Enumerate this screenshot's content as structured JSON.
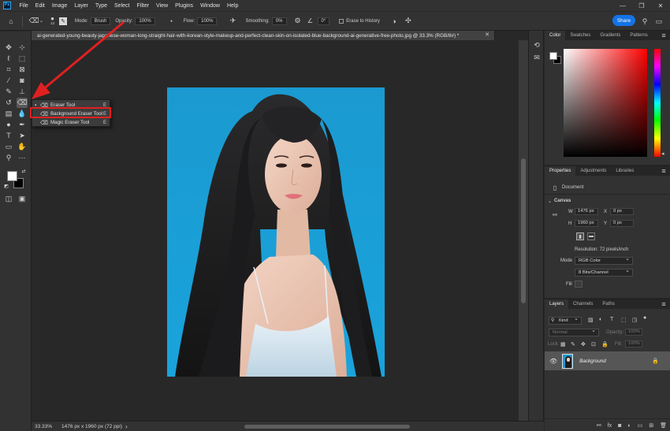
{
  "app": {
    "logo": "Ps"
  },
  "menu": [
    "File",
    "Edit",
    "Image",
    "Layer",
    "Type",
    "Select",
    "Filter",
    "View",
    "Plugins",
    "Window",
    "Help"
  ],
  "window_controls": [
    "minimize-icon",
    "restore-icon",
    "close-icon"
  ],
  "options": {
    "mode_label": "Mode:",
    "mode_value": "Brush",
    "opacity_label": "Opacity:",
    "opacity_value": "100%",
    "flow_label": "Flow:",
    "flow_value": "100%",
    "smoothing_label": "Smoothing:",
    "smoothing_value": "0%",
    "angle_value": "0°",
    "erase_history_label": "Erase to History",
    "brush_size": "13",
    "share_label": "Share"
  },
  "document": {
    "tab_title": "ai-generated-young-beauty-japanese-woman-long-straight-hair-with-korean-style-makeup-and-perfect-clean-skin-on-isolated-blue-background-ai-generative-free-photo.jpg @ 33.3% (RGB/8#) *",
    "zoom": "33.33%",
    "dimensions_status": "1476 px x 1960 px (72 ppi)"
  },
  "flyout": {
    "items": [
      {
        "label": "Eraser Tool",
        "key": "E"
      },
      {
        "label": "Background Eraser Tool",
        "key": "E"
      },
      {
        "label": "Magic Eraser Tool",
        "key": "E"
      }
    ]
  },
  "color_panel": {
    "tabs": [
      "Color",
      "Swatches",
      "Gradients",
      "Patterns"
    ]
  },
  "properties": {
    "tabs": [
      "Properties",
      "Adjustments",
      "Libraries"
    ],
    "document_label": "Document",
    "canvas_label": "Canvas",
    "w_label": "W",
    "w_value": "1476 px",
    "h_label": "H",
    "h_value": "1960 px",
    "x_label": "X",
    "x_value": "0 px",
    "y_label": "Y",
    "y_value": "0 px",
    "resolution": "Resolution: 72 pixels/inch",
    "mode_label": "Mode",
    "mode_value": "RGB Color",
    "bits_value": "8 Bits/Channel",
    "fill_label": "Fill"
  },
  "layers": {
    "tabs": [
      "Layers",
      "Channels",
      "Paths"
    ],
    "kind_label": "Kind",
    "blend_mode": "Normal",
    "opacity_label": "Opacity:",
    "opacity_value": "100%",
    "lock_label": "Lock:",
    "fill_label": "Fill:",
    "fill_value": "100%",
    "layer_name": "Background"
  },
  "colors": {
    "accent": "#1473e6",
    "highlight": "#e02020",
    "photo_background": "#1d9fd6"
  }
}
